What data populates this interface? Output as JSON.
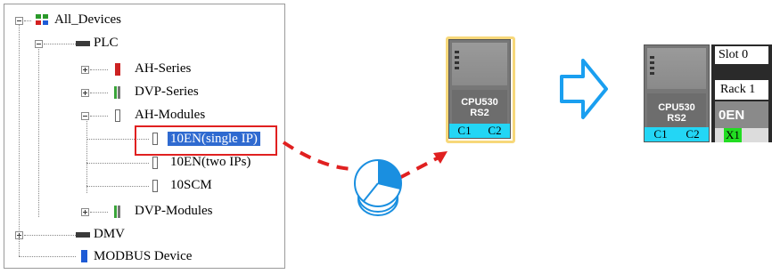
{
  "tree": {
    "root": "All_Devices",
    "plc": "PLC",
    "ah_series": "AH-Series",
    "dvp_series": "DVP-Series",
    "ah_modules": "AH-Modules",
    "selected_item": "10EN(single IP)",
    "item_two_ips": "10EN(two IPs)",
    "item_10scm": "10SCM",
    "dvp_modules": "DVP-Modules",
    "dmv": "DMV",
    "modbus": "MODBUS Device"
  },
  "module_single": {
    "cpu_name_line1": "CPU530",
    "cpu_name_line2": "RS2",
    "port1": "C1",
    "port2": "C2"
  },
  "module_result": {
    "cpu_name_line1": "CPU530",
    "cpu_name_line2": "RS2",
    "port1": "C1",
    "port2": "C2",
    "slot_label": "Slot 0",
    "rack_label": "Rack 1",
    "ext_name": "0EN",
    "ext_port": "X1"
  },
  "colors": {
    "selection": "#2f6ad0",
    "highlight_border": "#e02020",
    "port_strip": "#23d6f5",
    "ext_port": "#22dd22",
    "arrow": "#1aa0f0"
  }
}
